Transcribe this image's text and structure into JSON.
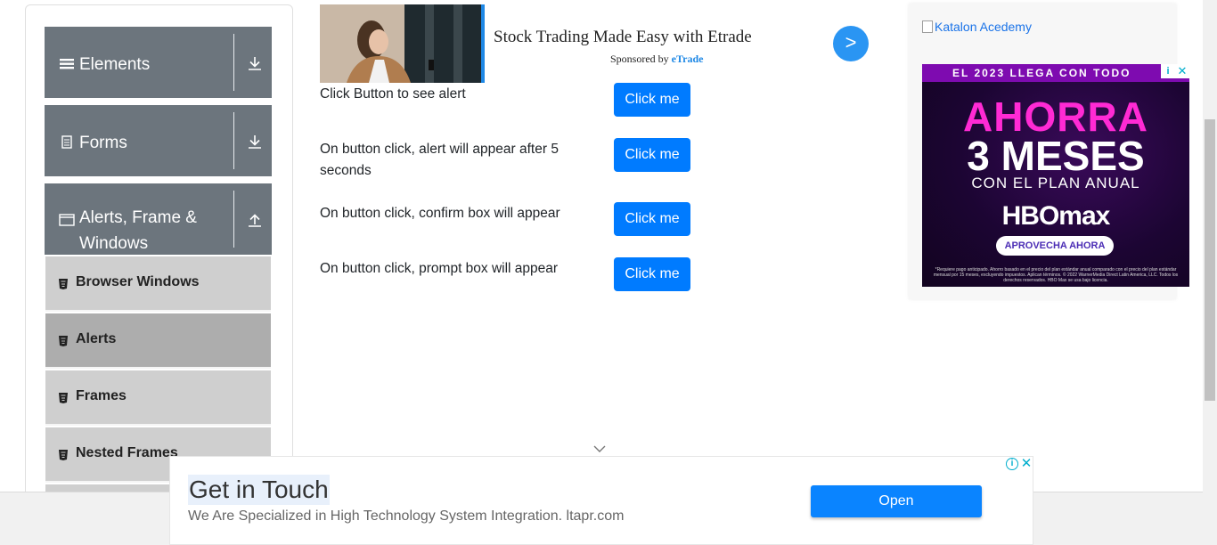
{
  "sidebar": {
    "groups": [
      {
        "label": "Elements",
        "icon": "hamburger-icon",
        "arrow": "download-icon"
      },
      {
        "label": "Forms",
        "icon": "document-icon",
        "arrow": "download-icon"
      },
      {
        "label": "Alerts, Frame & Windows",
        "icon": "window-icon",
        "arrow": "upload-icon"
      }
    ],
    "items": [
      {
        "label": "Browser Windows",
        "active": false
      },
      {
        "label": "Alerts",
        "active": true
      },
      {
        "label": "Frames",
        "active": false
      },
      {
        "label": "Nested Frames",
        "active": false
      }
    ]
  },
  "top_ad": {
    "title": "Stock Trading Made Easy with Etrade",
    "sponsored_prefix": "Sponsored by",
    "sponsor": "eTrade",
    "go_label": ">"
  },
  "alerts": [
    {
      "text": "Click Button to see alert",
      "button": "Click me"
    },
    {
      "text": "On button click, alert will appear after 5 seconds",
      "button": "Click me"
    },
    {
      "text": "On button click, confirm box will appear",
      "button": "Click me"
    },
    {
      "text": "On button click, prompt box will appear",
      "button": "Click me"
    }
  ],
  "right_ad": {
    "broken_image_alt": "Katalon Acedemy",
    "banner": {
      "topline": "EL 2023 LLEGA CON TODO",
      "headline1": "AHORRA",
      "headline2": "3 MESES",
      "subline": "CON EL PLAN ANUAL",
      "brand": "HBOmax",
      "cta": "APROVECHA AHORA",
      "fine_print": "*Requiere pago anticipado. Ahorro basado en el precio del plan estándar anual comparado con el precio del plan estándar mensual por 15 meses, excluyendo impuestos. Aplican términos. © 2022 WarnerMedia Direct Latin America, LLC. Todos los derechos reservados. HBO Max se usa bajo licencia."
    }
  },
  "bottom_ad": {
    "title": "Get in Touch",
    "subtitle": "We Are Specialized in High Technology System Integration. ltapr.com",
    "button": "Open"
  },
  "colors": {
    "sidebar_header": "#6c757d",
    "sub_item": "#cfcfcf",
    "sub_item_active": "#adadad",
    "primary": "#007bff"
  }
}
